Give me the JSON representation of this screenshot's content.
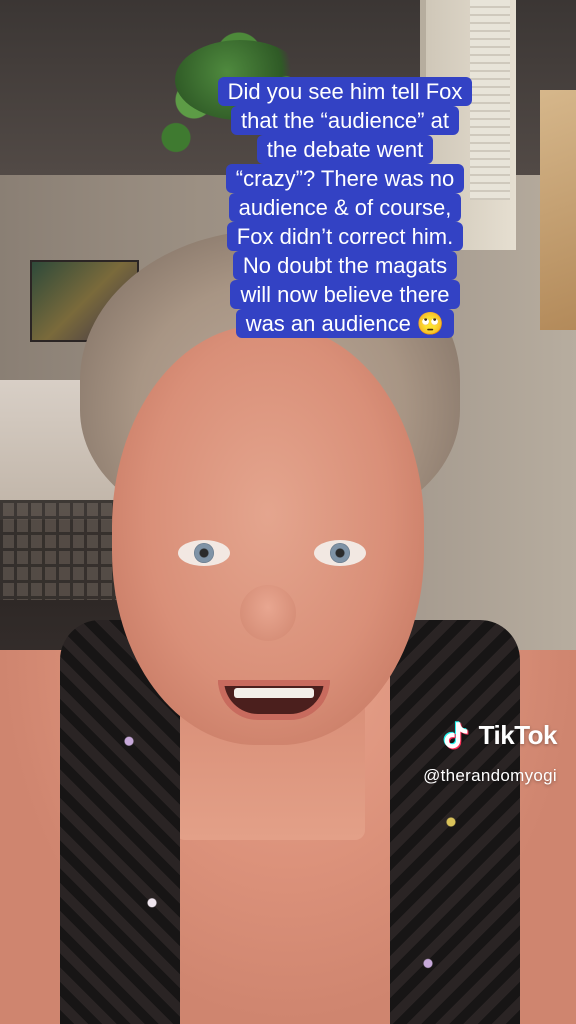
{
  "caption": {
    "lines": [
      "Did you see him tell Fox",
      "that the “audience” at",
      "the debate went",
      "“crazy”? There was no",
      "audience & of course,",
      "Fox didn’t correct him.",
      "No doubt the magats",
      "will now believe there",
      "was an audience 🙄"
    ],
    "background_color": "#3342c4",
    "text_color": "#ffffff"
  },
  "watermark": {
    "brand": "TikTok",
    "handle": "@therandomyogi",
    "icon": "tiktok-logo-icon"
  }
}
